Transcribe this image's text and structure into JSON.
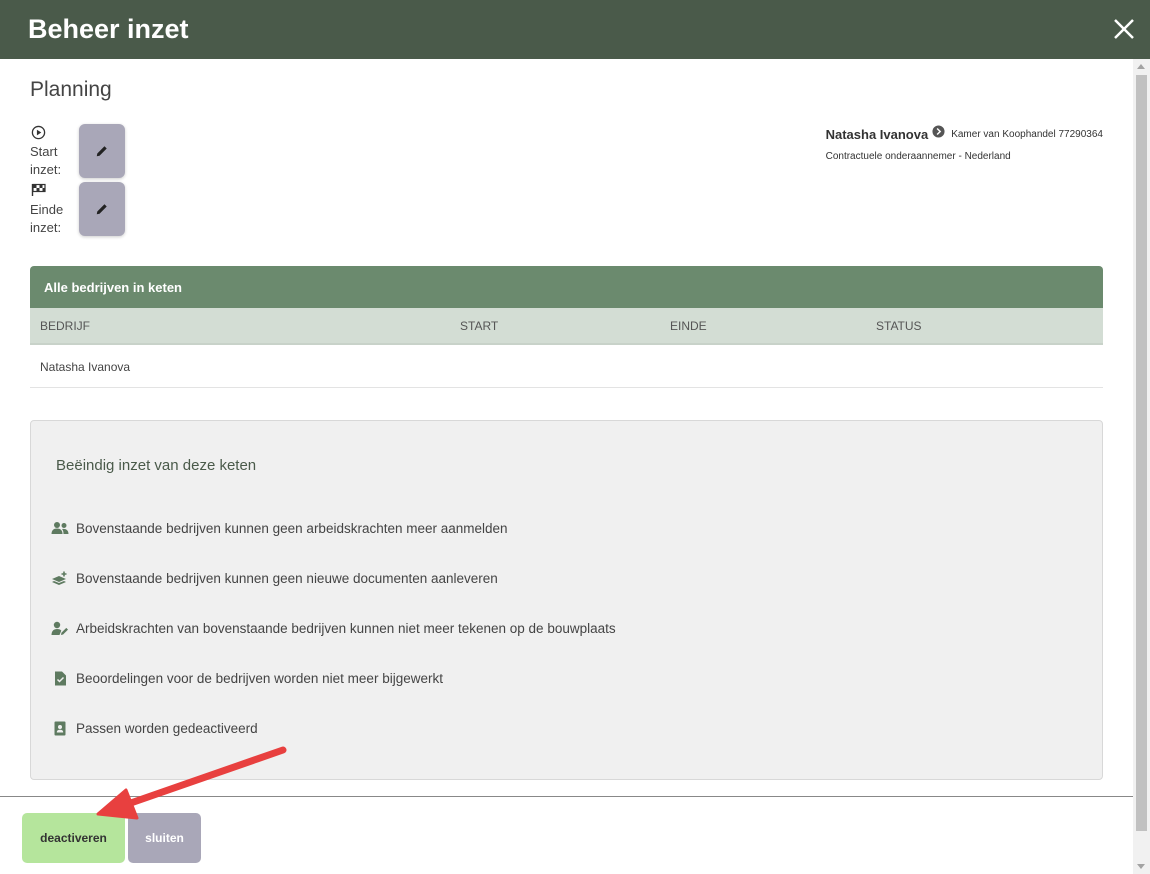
{
  "header": {
    "title": "Beheer inzet"
  },
  "planning": {
    "title": "Planning",
    "start_label": "Start inzet:",
    "end_label": "Einde inzet:"
  },
  "company": {
    "name": "Natasha Ivanova",
    "kvk": "Kamer van Koophandel 77290364",
    "type": "Contractuele onderaannemer - Nederland"
  },
  "table": {
    "title": "Alle bedrijven in keten",
    "columns": [
      "Bedrijf",
      "Start",
      "Einde",
      "Status"
    ],
    "rows": [
      {
        "bedrijf": "Natasha Ivanova",
        "start": "",
        "einde": "",
        "status": ""
      }
    ]
  },
  "info": {
    "title": "Beëindig inzet van deze keten",
    "items": [
      {
        "icon": "users-icon",
        "text": "Bovenstaande bedrijven kunnen geen arbeidskrachten meer aanmelden"
      },
      {
        "icon": "layers-plus-icon",
        "text": "Bovenstaande bedrijven kunnen geen nieuwe documenten aanleveren"
      },
      {
        "icon": "user-pen-icon",
        "text": "Arbeidskrachten van bovenstaande bedrijven kunnen niet meer tekenen op de bouwplaats"
      },
      {
        "icon": "file-check-icon",
        "text": "Beoordelingen voor de bedrijven worden niet meer bijgewerkt"
      },
      {
        "icon": "badge-card-icon",
        "text": "Passen worden gedeactiveerd"
      }
    ]
  },
  "footer": {
    "deactivate_label": "deactiveren",
    "close_label": "sluiten"
  },
  "colors": {
    "header_bg": "#4a5a4a",
    "table_header_bg": "#6b8a6e",
    "primary_button": "#b5e59c",
    "secondary_button": "#a9a7b8",
    "arrow": "#e8403f"
  }
}
